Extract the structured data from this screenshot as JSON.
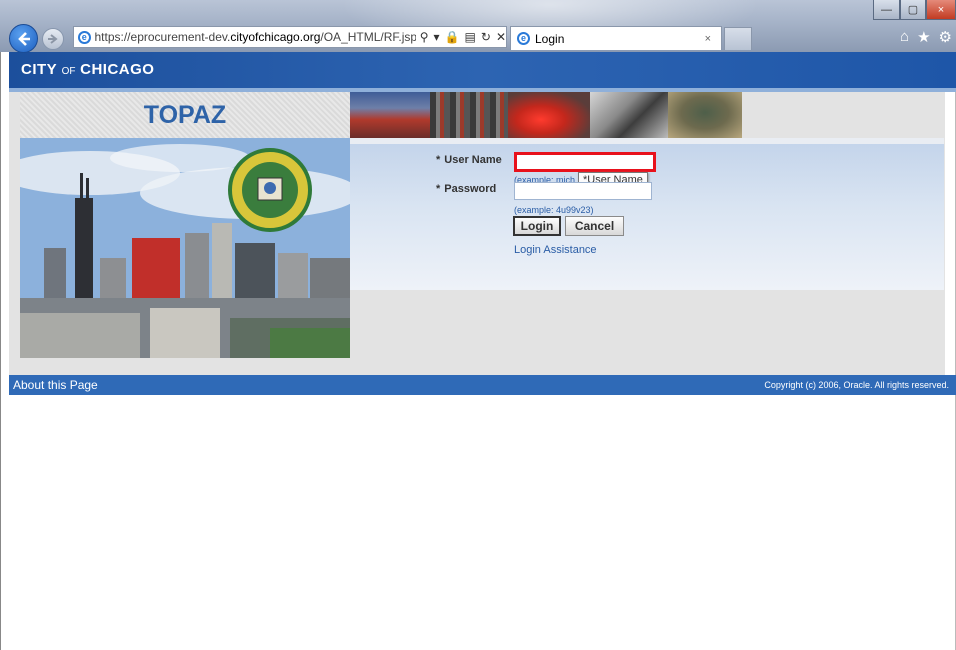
{
  "browser": {
    "url_prefix": "https://eprocurement-dev.",
    "url_domain": "cityofchicago.org",
    "url_path": "/OA_HTML/RF.jsp",
    "tab_title": "Login",
    "tab_close": "×",
    "window_min": "—",
    "window_max": "▢",
    "window_close": "×"
  },
  "brand": {
    "city": "CITY",
    "of": "OF",
    "chicago": "CHICAGO"
  },
  "app": {
    "title": "TOPAZ"
  },
  "login": {
    "username_required": "*",
    "username_label": "User Name",
    "username_value": "",
    "username_example": "(example: mich",
    "username_tooltip": "*User Name",
    "password_required": "*",
    "password_label": "Password",
    "password_example": "(example: 4u99v23)",
    "login_button": "Login",
    "cancel_button": "Cancel",
    "assistance_link": "Login Assistance"
  },
  "footer": {
    "about": "About this Page",
    "copyright": "Copyright (c) 2006, Oracle. All rights reserved."
  }
}
